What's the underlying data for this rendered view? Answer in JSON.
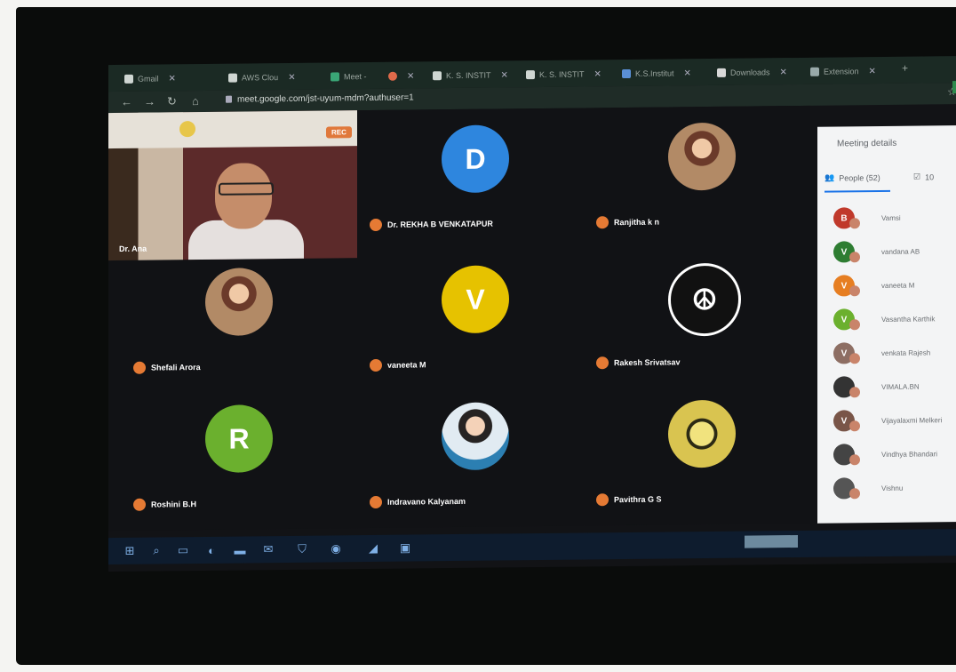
{
  "browser": {
    "tabs": [
      {
        "label": "Gmail"
      },
      {
        "label": "AWS Clou"
      },
      {
        "label": "Meet -"
      },
      {
        "label": ""
      },
      {
        "label": "K. S. INSTIT"
      },
      {
        "label": "K. S. INSTIT"
      },
      {
        "label": "K.S.Institut"
      },
      {
        "label": "Downloads"
      },
      {
        "label": "Extension"
      }
    ],
    "url": "meet.google.com/jst-uyum-mdm?authuser=1"
  },
  "meeting": {
    "main_speaker": {
      "label": "Dr. Ana",
      "rec_label": "REC"
    },
    "participants": [
      {
        "name": "Dr. REKHA B VENKATAPUR",
        "initial": "D",
        "color": "#2e86de",
        "kind": "letter"
      },
      {
        "name": "Ranjitha k n",
        "initial": "",
        "color": "#b07a50",
        "kind": "photo"
      },
      {
        "name": "Shefali Arora",
        "initial": "",
        "color": "#8a6a5a",
        "kind": "photo"
      },
      {
        "name": "vaneeta M",
        "initial": "V",
        "color": "#e6c200",
        "kind": "letter"
      },
      {
        "name": "Rakesh Srivatsav",
        "initial": "",
        "color": "#111",
        "kind": "peace"
      },
      {
        "name": "Roshini B.H",
        "initial": "R",
        "color": "#6bb02e",
        "kind": "letter"
      },
      {
        "name": "Indravano Kalyanam",
        "initial": "",
        "color": "#2c7fb2",
        "kind": "photo2"
      },
      {
        "name": "Pavithra G S",
        "initial": "",
        "color": "#d9c450",
        "kind": "medal"
      }
    ]
  },
  "side_panel": {
    "title": "Meeting details",
    "tab_people": "People (52)",
    "tab_chat_count": "10",
    "people": [
      {
        "name": "Vamsi",
        "initial": "B",
        "color": "#c0392b"
      },
      {
        "name": "vandana AB",
        "initial": "V",
        "color": "#2e7d32"
      },
      {
        "name": "vaneeta M",
        "initial": "V",
        "color": "#e67e22"
      },
      {
        "name": "Vasantha Karthik",
        "initial": "V",
        "color": "#6bb02e"
      },
      {
        "name": "venkata Rajesh",
        "initial": "V",
        "color": "#8d6e63"
      },
      {
        "name": "VIMALA.BN",
        "initial": "",
        "color": "#333333"
      },
      {
        "name": "Vijayalaxmi Melkeri",
        "initial": "V",
        "color": "#795548"
      },
      {
        "name": "Vindhya Bhandari",
        "initial": "",
        "color": "#444444"
      },
      {
        "name": "Vishnu",
        "initial": "",
        "color": "#555555"
      }
    ]
  },
  "taskbar": {
    "icons": [
      "windows-icon",
      "search-icon",
      "task-view-icon",
      "edge-icon",
      "file-explorer-icon",
      "mail-icon",
      "shield-icon",
      "store-icon",
      "photos-icon",
      "app-icon"
    ]
  }
}
